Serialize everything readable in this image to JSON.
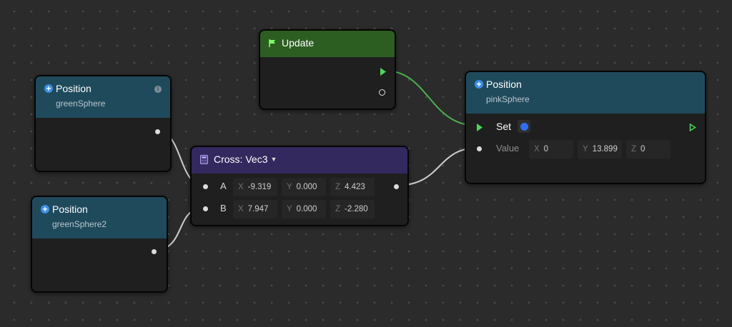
{
  "nodes": {
    "position_green": {
      "title": "Position",
      "subtitle": "greenSphere"
    },
    "position_green2": {
      "title": "Position",
      "subtitle": "greenSphere2"
    },
    "update": {
      "title": "Update"
    },
    "cross": {
      "title": "Cross: Vec3",
      "inputs": [
        {
          "label": "A",
          "x": "-9.319",
          "y": "0.000",
          "z": "4.423"
        },
        {
          "label": "B",
          "x": "7.947",
          "y": "0.000",
          "z": "-2.280"
        }
      ]
    },
    "position_pink": {
      "title": "Position",
      "subtitle": "pinkSphere",
      "set_label": "Set",
      "value_label": "Value",
      "value": {
        "x": "0",
        "y": "13.899",
        "z": "0"
      }
    }
  },
  "axis_labels": {
    "x": "X",
    "y": "Y",
    "z": "Z"
  },
  "colors": {
    "position_header": "#1f4a5c",
    "update_header": "#2c5e22",
    "cross_header": "#33295e",
    "exec_wire": "#4caf50",
    "data_wire": "#cfcfcf",
    "set_color": "#2f6ff0"
  },
  "icons": {
    "position": "plus-circle-icon",
    "update": "flag-icon",
    "cross": "calculator-icon",
    "info": "info-icon"
  }
}
